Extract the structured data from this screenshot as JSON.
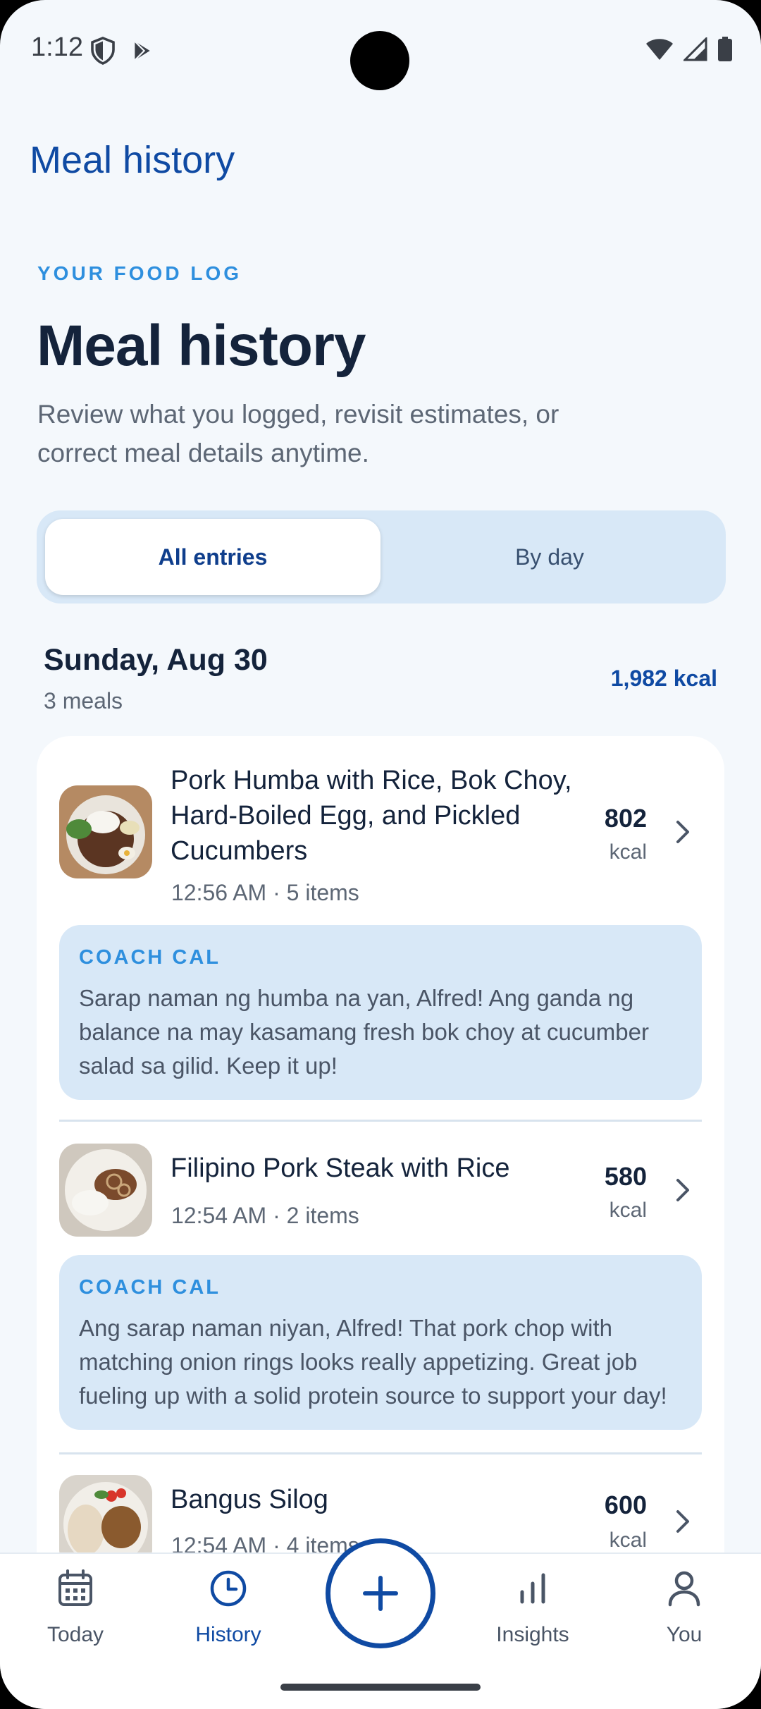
{
  "status_bar": {
    "time": "1:12"
  },
  "app_bar": {
    "title": "Meal history"
  },
  "hero": {
    "eyebrow": "YOUR FOOD LOG",
    "title": "Meal history",
    "subtitle": "Review what you logged, revisit estimates, or correct meal details anytime."
  },
  "segmented": {
    "options": [
      "All entries",
      "By day"
    ],
    "selected": "All entries"
  },
  "day": {
    "title": "Sunday, Aug 30",
    "count": "3 meals",
    "total_kcal": "1,982 kcal"
  },
  "meals": [
    {
      "name": "Pork Humba with Rice, Bok Choy, Hard-Boiled Egg, and Pickled Cucumbers",
      "meta": "12:56 AM · 5 items",
      "kcal": "802",
      "kcal_unit": "kcal",
      "coach_label": "COACH CAL",
      "coach_text": "Sarap naman ng humba na yan, Alfred! Ang ganda ng balance na may kasamang fresh bok choy at cucumber salad sa gilid. Keep it up!"
    },
    {
      "name": "Filipino Pork Steak with Rice",
      "meta": "12:54 AM · 2 items",
      "kcal": "580",
      "kcal_unit": "kcal",
      "coach_label": "COACH CAL",
      "coach_text": "Ang sarap naman niyan, Alfred! That pork chop with matching onion rings looks really appetizing. Great job fueling up with a solid protein source to support your day!"
    },
    {
      "name": "Bangus Silog",
      "meta": "12:54 AM · 4 items",
      "kcal": "600",
      "kcal_unit": "kcal"
    }
  ],
  "bottom_nav": {
    "items": [
      {
        "label": "Today",
        "icon": "calendar-icon"
      },
      {
        "label": "History",
        "icon": "clock-icon"
      },
      {
        "label": "Insights",
        "icon": "bar-chart-icon"
      },
      {
        "label": "You",
        "icon": "person-icon"
      }
    ],
    "active": "History",
    "fab_icon": "plus-icon"
  },
  "colors": {
    "primary": "#0f4aa3",
    "accent": "#2e8fde",
    "background": "#f4f8fc",
    "coach_bg": "#d8e8f7"
  }
}
